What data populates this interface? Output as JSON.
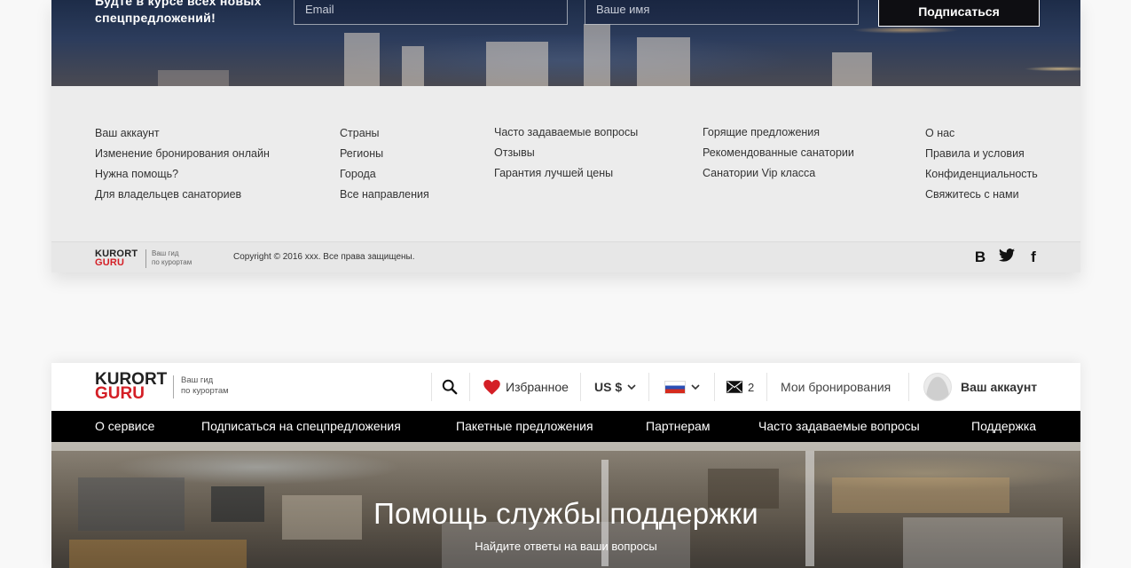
{
  "subscribe": {
    "text_line1": "Будте в курсе всех новых",
    "text_line2": "спецпредложений!",
    "email_placeholder": "Email",
    "name_placeholder": "Ваше имя",
    "button_label": "Подписаться"
  },
  "footer_links": {
    "col1": [
      "Ваш аккаунт",
      "Изменение бронирования онлайн",
      "Нужна помощь?",
      "Для владельцев санаториев"
    ],
    "col2": [
      "Страны",
      "Регионы",
      "Города",
      "Все направления"
    ],
    "col3": [
      "Часто задаваемые вопросы",
      "Отзывы",
      "Гарантия лучшей цены"
    ],
    "col4": [
      "Горящие предложения",
      "Рекомендованные санатории",
      "Санатории Vip класса"
    ],
    "col5": [
      "О нас",
      "Правила и условия",
      "Конфиденциальность",
      "Свяжитесь с нами"
    ]
  },
  "footer_bottom": {
    "logo_line1": "KURORT",
    "logo_line2": "GURU",
    "tagline_line1": "Ваш гид",
    "tagline_line2": "по курортам",
    "copyright": "Copyright © 2016 xxx. Все права защищены.",
    "socials": [
      "B",
      "twitter-icon",
      "f"
    ]
  },
  "header": {
    "logo_line1": "KURORT",
    "logo_line2": "GURU",
    "tagline_line1": "Ваш гид",
    "tagline_line2": "по курортам",
    "favorites_label": "Избранное",
    "currency_label": "US $",
    "language_flag": "russia-flag-icon",
    "messages_count": "2",
    "bookings_label": "Мои бронирования",
    "account_label": "Ваш аккаунт"
  },
  "nav": {
    "items": [
      "О сервисе",
      "Подписаться на спецпредложения",
      "Пакетные предложения",
      "Партнерам",
      "Часто задаваемые вопросы",
      "Поддержка"
    ]
  },
  "hero": {
    "title": "Помощь службы поддержки",
    "subtitle": "Найдите ответы на ваши вопросы"
  },
  "colors": {
    "brand_red": "#d41f26",
    "nav_bg": "#000000",
    "footer_bg": "#ececec"
  }
}
